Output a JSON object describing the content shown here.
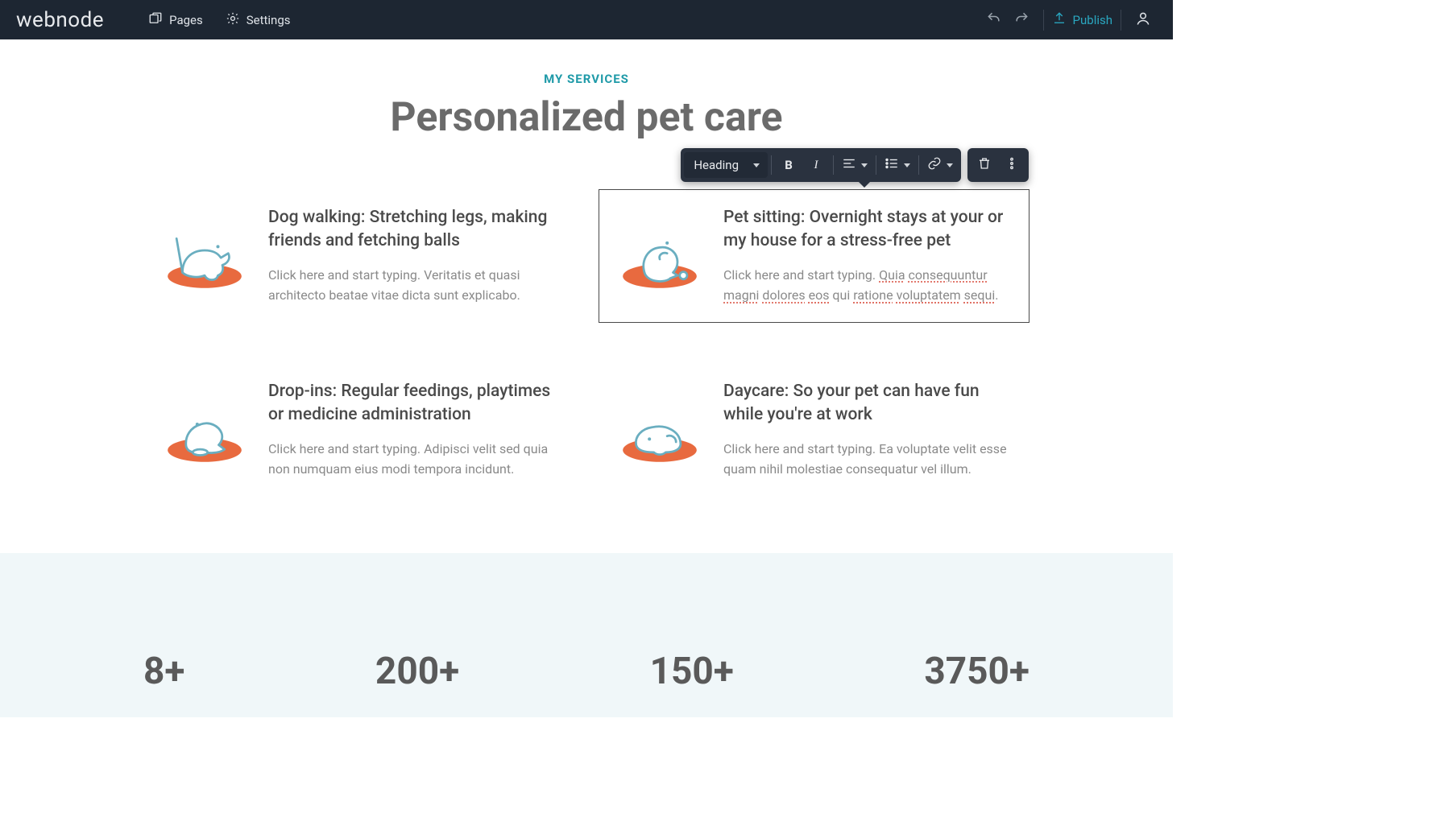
{
  "topbar": {
    "brand": "webnode",
    "pages": "Pages",
    "settings": "Settings",
    "publish": "Publish"
  },
  "hero": {
    "eyebrow": "MY SERVICES",
    "title": "Personalized pet care"
  },
  "toolbar": {
    "style_label": "Heading"
  },
  "cards": [
    {
      "title": "Dog walking: Stretching legs, making friends and fetching balls",
      "body": "Click here and start typing. Veritatis et quasi architecto beatae vitae dicta sunt explicabo."
    },
    {
      "title": "Pet sitting: Overnight stays at your or my house for a stress-free pet",
      "body_parts": [
        {
          "t": "Click here and start typing. ",
          "u": false
        },
        {
          "t": "Quia",
          "u": true
        },
        {
          "t": " ",
          "u": false
        },
        {
          "t": "consequuntur",
          "u": true
        },
        {
          "t": " ",
          "u": false
        },
        {
          "t": "magni",
          "u": true
        },
        {
          "t": " ",
          "u": false
        },
        {
          "t": "dolores",
          "u": true
        },
        {
          "t": " ",
          "u": false
        },
        {
          "t": "eos",
          "u": true
        },
        {
          "t": " qui ",
          "u": false
        },
        {
          "t": "ratione",
          "u": true
        },
        {
          "t": " ",
          "u": false
        },
        {
          "t": "voluptatem",
          "u": true
        },
        {
          "t": " ",
          "u": false
        },
        {
          "t": "sequi",
          "u": true
        },
        {
          "t": ".",
          "u": false
        }
      ]
    },
    {
      "title": "Drop-ins: Regular feedings, playtimes or medicine administration",
      "body": "Click here and start typing. Adipisci velit sed quia non numquam eius modi tempora incidunt."
    },
    {
      "title": "Daycare: So your pet can have fun while you're at work",
      "body": "Click here and start typing. Ea voluptate velit esse quam nihil molestiae consequatur vel illum."
    }
  ],
  "stats": [
    "8+",
    "200+",
    "150+",
    "3750+"
  ]
}
